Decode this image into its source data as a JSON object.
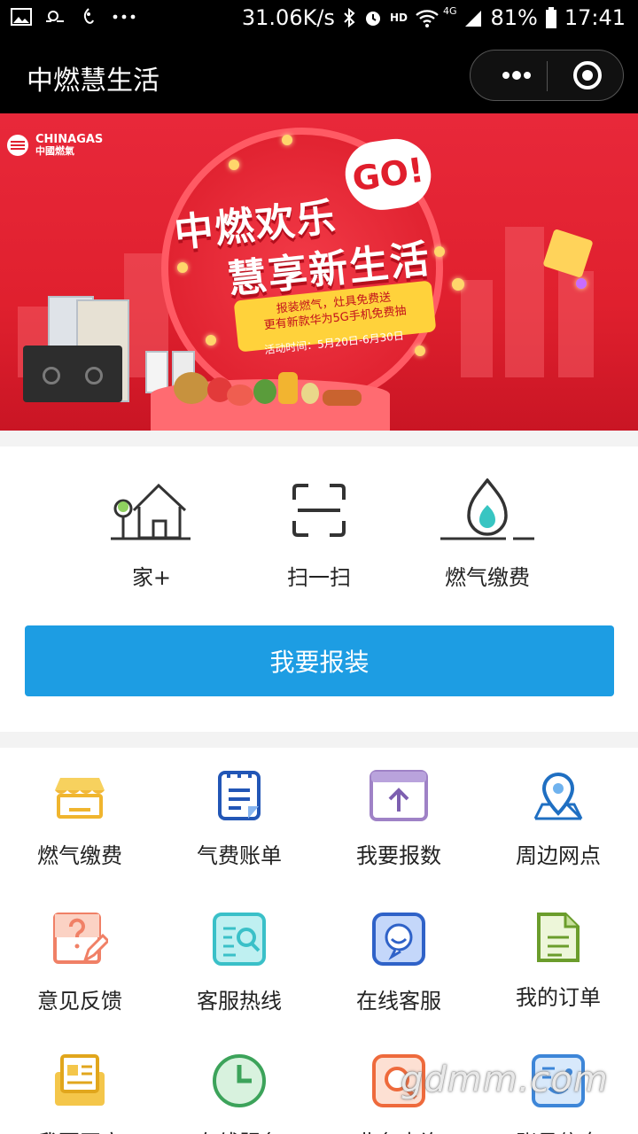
{
  "status_bar": {
    "speed": "31.06K/s",
    "hd": "HD",
    "net": "4G",
    "battery": "81%",
    "time": "17:41"
  },
  "nav": {
    "title": "中燃慧生活"
  },
  "banner": {
    "brand_en": "CHINAGAS",
    "brand_cn": "中國燃氣",
    "headline1": "中燃欢乐",
    "headline2": "慧享新生活",
    "go": "GO!",
    "promo_line1": "报装燃气，灶具免费送",
    "promo_line2": "更有新款华为5G手机免费抽",
    "dates": "活动时间：5月20日-6月30日"
  },
  "quick_actions": [
    {
      "label": "家+",
      "icon": "house-tree-icon"
    },
    {
      "label": "扫一扫",
      "icon": "scan-icon"
    },
    {
      "label": "燃气缴费",
      "icon": "flame-icon"
    }
  ],
  "report_button": "我要报装",
  "services": [
    {
      "label": "燃气缴费",
      "icon": "shop-icon"
    },
    {
      "label": "气费账单",
      "icon": "bill-icon"
    },
    {
      "label": "我要报数",
      "icon": "upload-icon"
    },
    {
      "label": "周边网点",
      "icon": "location-icon"
    },
    {
      "label": "意见反馈",
      "icon": "feedback-icon"
    },
    {
      "label": "客服热线",
      "icon": "hotline-icon"
    },
    {
      "label": "在线客服",
      "icon": "chat-icon"
    },
    {
      "label": "我的订单",
      "icon": "order-icon"
    },
    {
      "label": "我要开户",
      "icon": "account-open-icon"
    },
    {
      "label": "在线服务",
      "icon": "clock-icon"
    },
    {
      "label": "业务查询",
      "icon": "query-icon"
    },
    {
      "label": "账号信息",
      "icon": "account-info-icon"
    }
  ],
  "watermark": "gdmm.com",
  "colors": {
    "primary": "#1d9de3",
    "banner_red": "#e0202e",
    "text": "#222222"
  }
}
